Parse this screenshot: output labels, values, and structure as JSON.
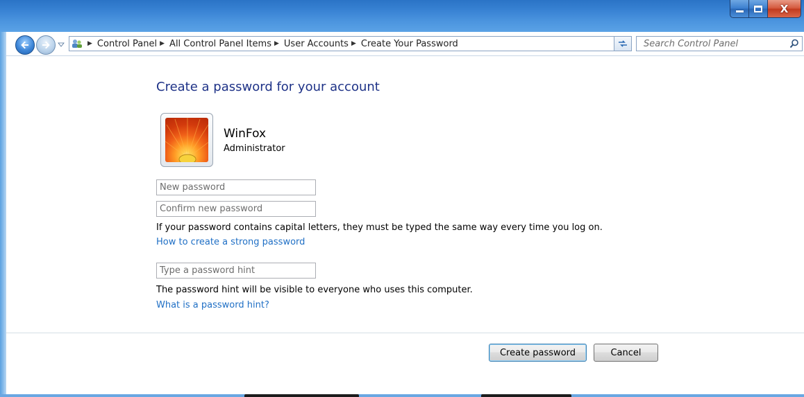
{
  "window": {
    "caption_buttons": {
      "minimize_icon": "minimize-icon",
      "maximize_icon": "maximize-icon",
      "close_label": "X"
    }
  },
  "navigation": {
    "back_icon": "back-arrow-icon",
    "forward_icon": "forward-arrow-icon",
    "breadcrumbs": [
      {
        "label": "Control Panel"
      },
      {
        "label": "All Control Panel Items"
      },
      {
        "label": "User Accounts"
      },
      {
        "label": "Create Your Password"
      }
    ],
    "search": {
      "placeholder": "Search Control Panel"
    }
  },
  "page": {
    "title": "Create a password for your account",
    "user": {
      "name": "WinFox",
      "role": "Administrator"
    },
    "fields": {
      "new_password_placeholder": "New password",
      "confirm_password_placeholder": "Confirm new password",
      "hint_placeholder": "Type a password hint"
    },
    "caps_notice": "If your password contains capital letters, they must be typed the same way every time you log on.",
    "strong_password_link": "How to create a strong password",
    "hint_notice": "The password hint will be visible to everyone who uses this computer.",
    "hint_link": "What is a password hint?"
  },
  "actions": {
    "create_label": "Create password",
    "cancel_label": "Cancel"
  },
  "colors": {
    "title_text": "#1e3287",
    "link_text": "#1f6fc5",
    "titlebar": "#3c86d6"
  }
}
